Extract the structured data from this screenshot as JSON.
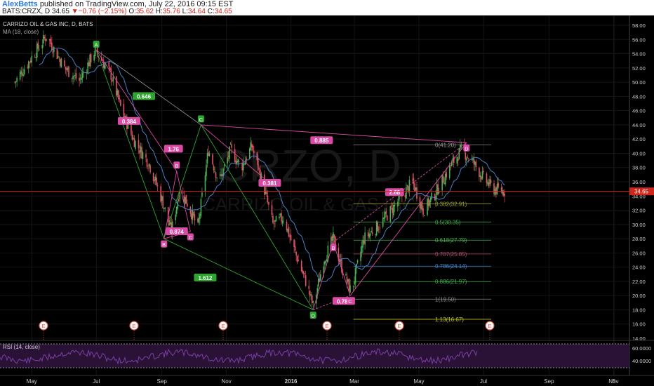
{
  "header": {
    "user": "AlexBetts",
    "published": "published on TradingView.com, July 22, 2016 09:15 EST",
    "symbol": "BATS:CRZX, D",
    "last": "34.65",
    "change": "▼−0.76 (−2.15%)",
    "o_label": "O:",
    "o": "35.62",
    "h_label": "H:",
    "h": "35.76",
    "l_label": "L:",
    "l": "34.64",
    "c_label": "C:",
    "c": "34.65"
  },
  "legend": {
    "name": "CARRIZO OIL & GAS INC, D, BATS",
    "ma": "MA (18, close)",
    "rsi": "RSI (14, close)"
  },
  "watermark": {
    "big": "CRZO, D",
    "small": "CARRIZO OIL & GAS INC"
  },
  "colors": {
    "up": "#4caf50",
    "down": "#e05566",
    "ma": "#4a7fc4",
    "pattern_green": "#2ea52e",
    "pattern_pink": "#d94aa5",
    "price_line": "#d0251b",
    "rsi": "#7b3fa6"
  },
  "chart_data": {
    "type": "candlestick",
    "y_ticks": [
      "58.00",
      "56.00",
      "54.00",
      "52.00",
      "50.00",
      "48.00",
      "46.00",
      "44.00",
      "42.00",
      "40.00",
      "38.00",
      "36.00",
      "34.00",
      "32.00",
      "30.00",
      "28.00",
      "26.00",
      "24.00",
      "22.00",
      "20.00",
      "18.00",
      "16.00",
      "14.00"
    ],
    "ylim": [
      14,
      58
    ],
    "x_ticks": [
      "May",
      "Jul",
      "Sep",
      "Nov",
      "2016",
      "Mar",
      "May",
      "Jul",
      "Sep",
      "Nov",
      "5"
    ],
    "current_price": "34.65",
    "price_path": [
      [
        "2015-04-15",
        50.0
      ],
      [
        "2015-05-01",
        53.5
      ],
      [
        "2015-05-15",
        56.5
      ],
      [
        "2015-06-01",
        52.0
      ],
      [
        "2015-06-15",
        50.2
      ],
      [
        "2015-06-30",
        54.5
      ],
      [
        "2015-07-15",
        51.0
      ],
      [
        "2015-07-25",
        46.0
      ],
      [
        "2015-08-05",
        42.0
      ],
      [
        "2015-08-20",
        38.5
      ],
      [
        "2015-09-01",
        33.5
      ],
      [
        "2015-09-10",
        29.0
      ],
      [
        "2015-09-18",
        35.0
      ],
      [
        "2015-09-25",
        33.0
      ],
      [
        "2015-10-05",
        29.5
      ],
      [
        "2015-10-15",
        40.5
      ],
      [
        "2015-10-25",
        36.0
      ],
      [
        "2015-11-05",
        40.5
      ],
      [
        "2015-11-15",
        38.0
      ],
      [
        "2015-11-25",
        41.0
      ],
      [
        "2015-12-05",
        36.0
      ],
      [
        "2015-12-15",
        30.0
      ],
      [
        "2015-12-25",
        31.0
      ],
      [
        "2016-01-05",
        26.0
      ],
      [
        "2016-01-15",
        22.0
      ],
      [
        "2016-01-22",
        18.5
      ],
      [
        "2016-02-01",
        25.0
      ],
      [
        "2016-02-10",
        28.0
      ],
      [
        "2016-02-20",
        23.0
      ],
      [
        "2016-02-27",
        20.5
      ],
      [
        "2016-03-10",
        28.0
      ],
      [
        "2016-03-25",
        30.0
      ],
      [
        "2016-04-10",
        33.0
      ],
      [
        "2016-04-25",
        36.0
      ],
      [
        "2016-05-05",
        32.0
      ],
      [
        "2016-05-15",
        34.0
      ],
      [
        "2016-05-30",
        38.0
      ],
      [
        "2016-06-10",
        40.5
      ],
      [
        "2016-06-20",
        39.0
      ],
      [
        "2016-07-01",
        36.5
      ],
      [
        "2016-07-10",
        35.0
      ],
      [
        "2016-07-21",
        34.65
      ]
    ],
    "patterns": [
      {
        "points": [
          {
            "label": "A",
            "date": "2015-07-01",
            "price": 54.5
          },
          {
            "label": "B",
            "date": "2015-09-03",
            "price": 28.0
          },
          {
            "label": "C",
            "date": "2015-10-08",
            "price": 44.0
          },
          {
            "label": "D",
            "date": "2016-01-22",
            "price": 18.0
          }
        ],
        "color": "green"
      },
      {
        "points": [
          {
            "label": "B",
            "date": "2015-09-03",
            "price": 28.0
          },
          {
            "label": "B",
            "date": "2015-09-15",
            "price": 37.5
          },
          {
            "label": "C",
            "date": "2015-09-28",
            "price": 29.0
          }
        ],
        "color": "pink"
      },
      {
        "points": [
          {
            "label": "B",
            "date": "2016-02-10",
            "price": 27.5
          },
          {
            "label": "C",
            "date": "2016-02-26",
            "price": 20.0
          },
          {
            "label": "D",
            "date": "2016-06-15",
            "price": 41.5
          }
        ],
        "color": "pink"
      }
    ],
    "ratios": [
      {
        "text": "0.646",
        "color": "green",
        "date": "2015-08-15",
        "price": 48.0
      },
      {
        "text": "0.384",
        "color": "pink",
        "date": "2015-08-01",
        "price": 44.5
      },
      {
        "text": "1.76",
        "color": "pink",
        "date": "2015-09-12",
        "price": 40.6
      },
      {
        "text": "0.874",
        "color": "pink",
        "date": "2015-09-15",
        "price": 29.0
      },
      {
        "text": "0.381",
        "color": "pink",
        "date": "2015-12-12",
        "price": 35.8
      },
      {
        "text": "0.885",
        "color": "pink",
        "date": "2016-01-30",
        "price": 41.8
      },
      {
        "text": "1.612",
        "color": "green",
        "date": "2015-10-12",
        "price": 22.5
      },
      {
        "text": "0.789",
        "color": "pink",
        "date": "2016-02-20",
        "price": 19.2
      },
      {
        "text": "2.68",
        "color": "pink",
        "date": "2016-04-08",
        "price": 34.5
      }
    ],
    "fib_levels": [
      {
        "label": "0.382(32.91)",
        "price": 32.91,
        "color": "#9a9a2a"
      },
      {
        "label": "0.5(30.35)",
        "price": 30.35,
        "color": "#3fb04a"
      },
      {
        "label": "0.618(27.79)",
        "price": 27.79,
        "color": "#3fb04a"
      },
      {
        "label": "0.707(25.85)",
        "price": 25.85,
        "color": "#b04a6a"
      },
      {
        "label": "0.786(24.14)",
        "price": 24.14,
        "color": "#3e86c9"
      },
      {
        "label": "0.886(21.97)",
        "price": 21.97,
        "color": "#3fb04a"
      },
      {
        "label": "1(19.50)",
        "price": 19.5,
        "color": "#8a8a8a"
      },
      {
        "label": "1.13(16.67)",
        "price": 16.67,
        "color": "#c7c72a"
      }
    ],
    "fib_top_label": "0(41.20)",
    "events": [
      "E",
      "E",
      "E",
      "E",
      "E",
      "E"
    ],
    "rsi_ticks": [
      "60.0000",
      "40.0000"
    ]
  }
}
